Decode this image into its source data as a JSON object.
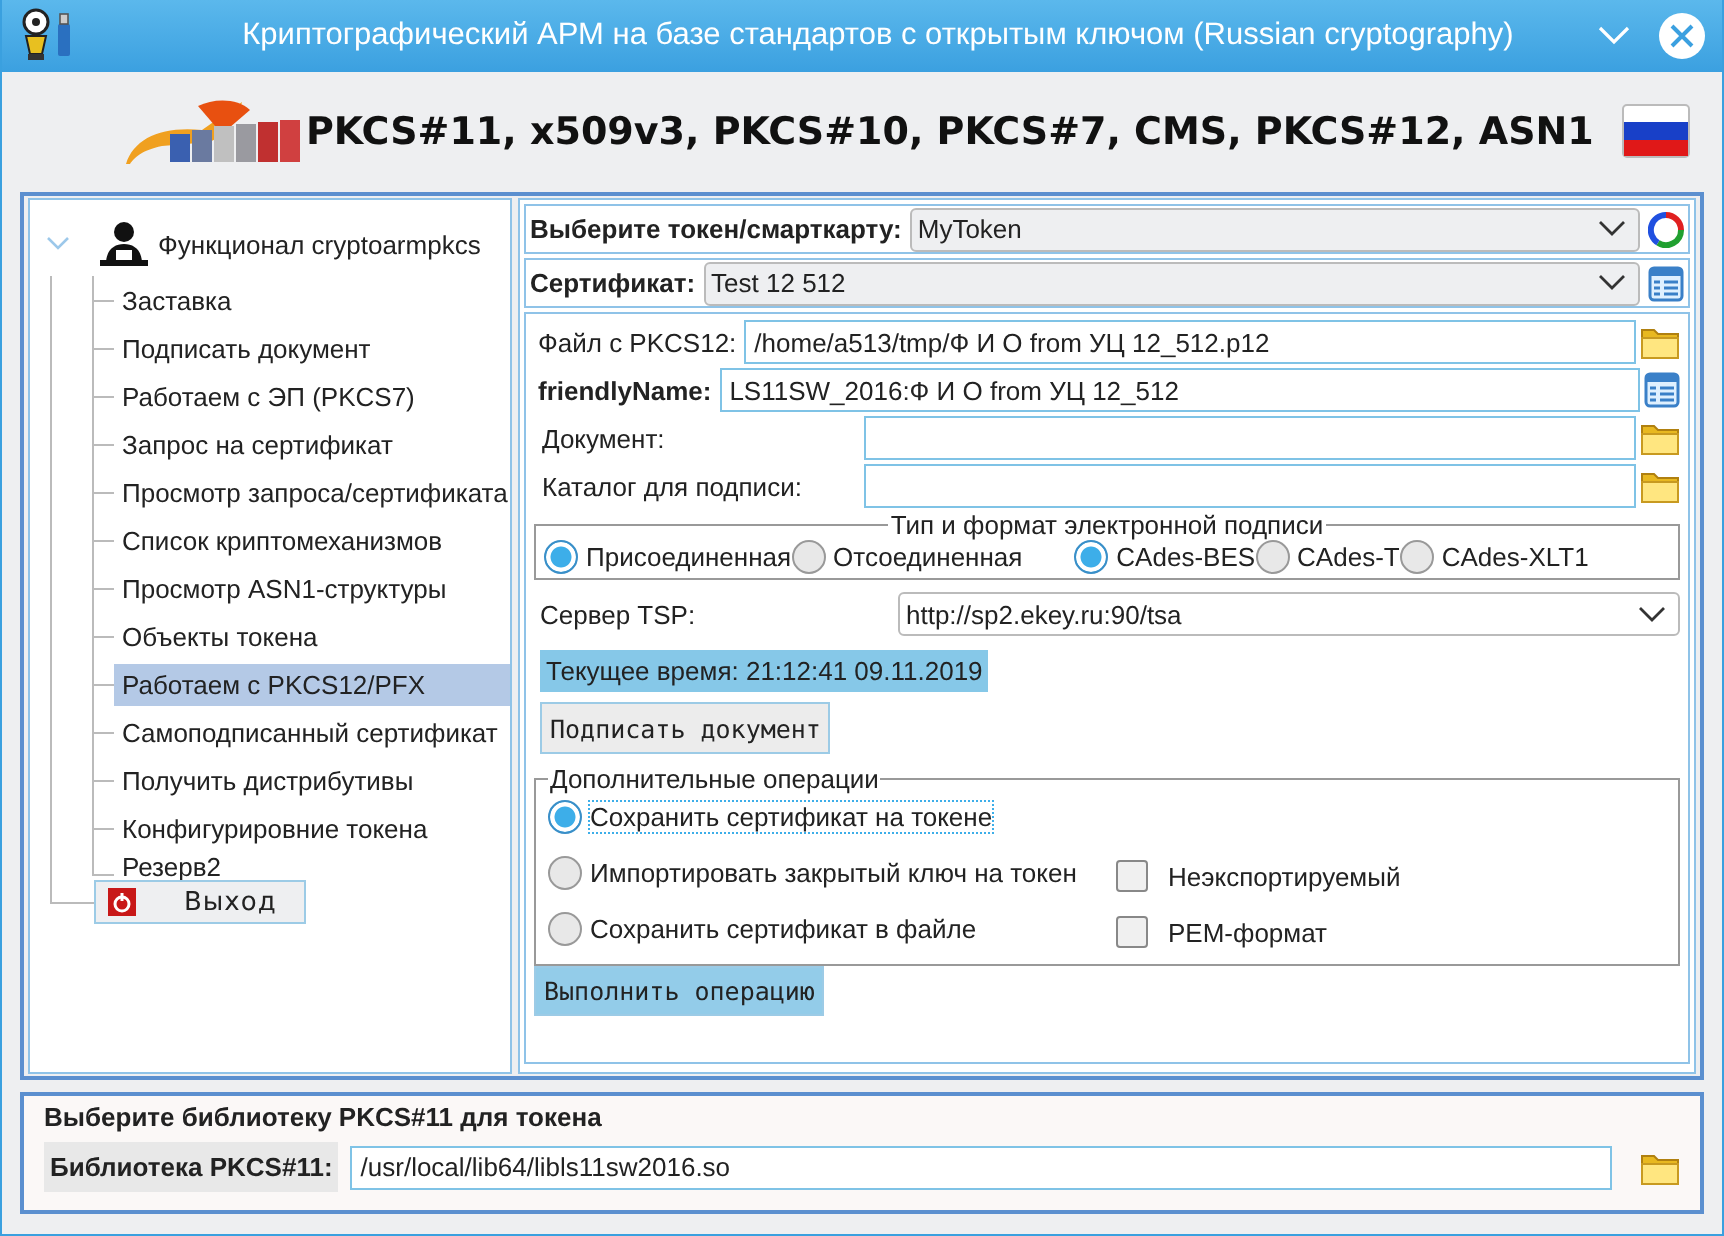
{
  "window": {
    "title": "Криптографический АРМ на базе стандартов с открытым ключом (Russian cryptography)"
  },
  "header": {
    "heading": "PKCS#11, x509v3, PKCS#10, PKCS#7, CMS, PKCS#12, ASN1"
  },
  "tree": {
    "root": "Функционал cryptoarmpkcs",
    "expanded": true,
    "children": [
      {
        "label": "Заставка",
        "selected": false
      },
      {
        "label": "Подписать документ",
        "selected": false
      },
      {
        "label": "Работаем с ЭП (PKCS7)",
        "selected": false
      },
      {
        "label": "Запрос на сертификат",
        "selected": false
      },
      {
        "label": "Просмотр запроса/сертификата",
        "selected": false
      },
      {
        "label": "Список криптомеханизмов",
        "selected": false
      },
      {
        "label": "Просмотр ASN1-структуры",
        "selected": false
      },
      {
        "label": "Объекты токена",
        "selected": false
      },
      {
        "label": "Работаем с PKCS12/PFX",
        "selected": true
      },
      {
        "label": "Самоподписанный сертификат",
        "selected": false
      },
      {
        "label": "Получить дистрибутивы",
        "selected": false
      },
      {
        "label": "Конфигурировние токена",
        "selected": false
      },
      {
        "label": "Резерв2",
        "selected": false
      }
    ]
  },
  "exit_button": "Выход",
  "token": {
    "label": "Выберите токен/смарткарту:",
    "value": "MyToken"
  },
  "certificate": {
    "label": "Сертификат:",
    "value": "Test 12 512"
  },
  "fields": [
    {
      "kind": "path",
      "label": "Файл с PKCS12:",
      "value": "/home/a513/tmp/Ф И О from УЦ 12_512.p12"
    },
    {
      "kind": "name",
      "label": "friendlyName:",
      "value": "LS11SW_2016:Ф И О from УЦ 12_512"
    },
    {
      "kind": "file",
      "label": "Документ:"
    },
    {
      "kind": "file",
      "label": "Каталог для подписи:"
    }
  ],
  "signature_format": {
    "title": "Тип и формат электронной подписи",
    "type_options": [
      {
        "label": "Присоединенная",
        "selected": true
      },
      {
        "label": "Отсоединенная",
        "selected": false
      }
    ],
    "format_options": [
      {
        "label": "CAdes-BES",
        "selected": true
      },
      {
        "label": "CAdes-T",
        "selected": false
      },
      {
        "label": "CAdes-XLT1",
        "selected": false
      }
    ]
  },
  "tsp": {
    "label": "Сервер TSP:",
    "value": "http://sp2.ekey.ru:90/tsa"
  },
  "current_time": "Текущее время: 21:12:41 09.11.2019",
  "sign_button": "Подписать документ",
  "operations": {
    "title": "Дополнительные операции",
    "options": [
      {
        "label": "Сохранить сертификат на токене",
        "selected": true
      },
      {
        "label": "Импортировать закрытый ключ на токен",
        "selected": false
      },
      {
        "label": "Сохранить сертификат в файле",
        "selected": false
      }
    ],
    "checkboxes": [
      {
        "label": "Неэкспортируемый",
        "checked": false
      },
      {
        "label": "PEM-формат",
        "checked": false
      }
    ]
  },
  "execute_button": "Выполнить операцию",
  "library": {
    "title": "Выберите библиотеку PKCS#11 для токена",
    "label": "Библиотека PKCS#11:",
    "value": "/usr/local/lib64/libls11sw2016.so"
  }
}
